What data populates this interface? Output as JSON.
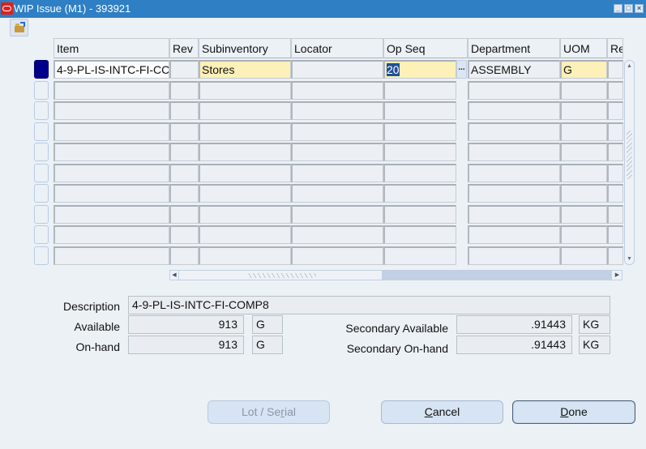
{
  "window": {
    "title": "WIP Issue (M1) - 393921",
    "controls": [
      "minimize",
      "maximize",
      "close"
    ]
  },
  "toolbar": {
    "open_icon": "folder-open-icon"
  },
  "grid": {
    "columns": [
      "Item",
      "Rev",
      "Subinventory",
      "Locator",
      "Op Seq",
      "Department",
      "UOM",
      "Re"
    ],
    "rows": [
      {
        "item": "4-9-PL-IS-INTC-FI-CC",
        "rev": "",
        "subinventory": "Stores",
        "locator": "",
        "op_seq": "20",
        "department": "ASSEMBLY",
        "uom": "G",
        "re": ""
      },
      {
        "item": "",
        "rev": "",
        "subinventory": "",
        "locator": "",
        "op_seq": "",
        "department": "",
        "uom": "",
        "re": ""
      },
      {
        "item": "",
        "rev": "",
        "subinventory": "",
        "locator": "",
        "op_seq": "",
        "department": "",
        "uom": "",
        "re": ""
      },
      {
        "item": "",
        "rev": "",
        "subinventory": "",
        "locator": "",
        "op_seq": "",
        "department": "",
        "uom": "",
        "re": ""
      },
      {
        "item": "",
        "rev": "",
        "subinventory": "",
        "locator": "",
        "op_seq": "",
        "department": "",
        "uom": "",
        "re": ""
      },
      {
        "item": "",
        "rev": "",
        "subinventory": "",
        "locator": "",
        "op_seq": "",
        "department": "",
        "uom": "",
        "re": ""
      },
      {
        "item": "",
        "rev": "",
        "subinventory": "",
        "locator": "",
        "op_seq": "",
        "department": "",
        "uom": "",
        "re": ""
      },
      {
        "item": "",
        "rev": "",
        "subinventory": "",
        "locator": "",
        "op_seq": "",
        "department": "",
        "uom": "",
        "re": ""
      },
      {
        "item": "",
        "rev": "",
        "subinventory": "",
        "locator": "",
        "op_seq": "",
        "department": "",
        "uom": "",
        "re": ""
      },
      {
        "item": "",
        "rev": "",
        "subinventory": "",
        "locator": "",
        "op_seq": "",
        "department": "",
        "uom": "",
        "re": ""
      }
    ],
    "lov_button": "..."
  },
  "details": {
    "description_label": "Description",
    "description_value": "4-9-PL-IS-INTC-FI-COMP8",
    "available_label": "Available",
    "available_value": "913",
    "available_uom": "G",
    "onhand_label": "On-hand",
    "onhand_value": "913",
    "onhand_uom": "G",
    "sec_available_label": "Secondary Available",
    "sec_available_value": ".91443",
    "sec_available_uom": "KG",
    "sec_onhand_label": "Secondary On-hand",
    "sec_onhand_value": ".91443",
    "sec_onhand_uom": "KG"
  },
  "buttons": {
    "lot_serial": {
      "pre": "Lot / Se",
      "mnemonic": "r",
      "post": "ial",
      "enabled": false
    },
    "cancel": {
      "pre": "",
      "mnemonic": "C",
      "post": "ancel",
      "enabled": true
    },
    "done": {
      "pre": "",
      "mnemonic": "D",
      "post": "one",
      "enabled": true
    }
  },
  "colors": {
    "titlebar": "#2e7fc4",
    "current_row_indicator": "#00008b",
    "required_field": "#fdf0b8",
    "background": "#ecf1f6"
  }
}
